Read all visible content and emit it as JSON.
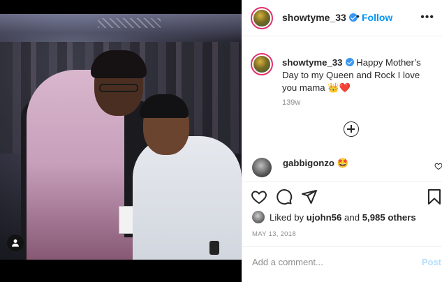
{
  "post": {
    "username": "showtyme_33",
    "separator": "•",
    "follow_label": "Follow",
    "more_icon": "more-horizontal-icon",
    "caption_text": "Happy Mother’s Day to my Queen and Rock I love you mama 👑❤️",
    "caption_age": "139w",
    "load_more_icon": "plus-circle-icon"
  },
  "comments": [
    {
      "username": "gabbigonzo",
      "text": "🤩"
    }
  ],
  "actions": {
    "icons": [
      "heart-icon",
      "comment-icon",
      "share-icon",
      "bookmark-icon"
    ],
    "liked_by_prefix": "Liked by",
    "liked_by_user": "ujohn56",
    "liked_by_conj": "and",
    "likes_count": "5,985 others",
    "date": "MAY 13, 2018"
  },
  "add_comment": {
    "placeholder": "Add a comment...",
    "post_label": "Post"
  },
  "colors": {
    "accent": "#0095f6",
    "post_disabled": "#b2dffc",
    "muted": "#8e8e8e",
    "text": "#262626",
    "border": "#efefef"
  }
}
